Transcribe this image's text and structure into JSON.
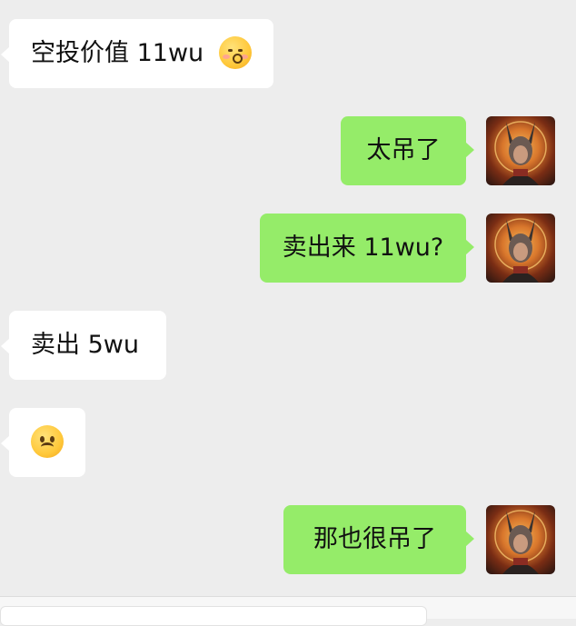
{
  "messages": [
    {
      "side": "in",
      "text": "空投价值 11wu",
      "emoji": "shushing-face-icon"
    },
    {
      "side": "out",
      "text": "太吊了"
    },
    {
      "side": "out",
      "text": "卖出来 11wu?"
    },
    {
      "side": "in",
      "text": "卖出 5wu"
    },
    {
      "side": "in",
      "text": "",
      "emoji": "frowning-face-icon"
    },
    {
      "side": "out",
      "text": "那也很吊了"
    }
  ],
  "colors": {
    "background": "#ededed",
    "incoming_bubble": "#ffffff",
    "outgoing_bubble": "#95ec69"
  }
}
